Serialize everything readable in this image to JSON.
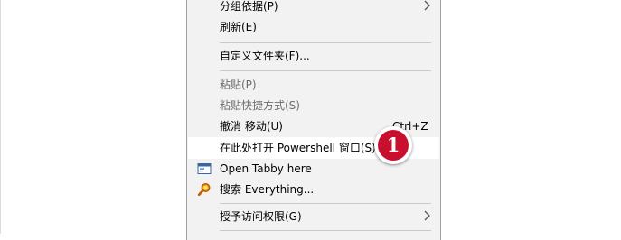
{
  "menu": {
    "items": [
      {
        "label": "分组依据(P)",
        "has_submenu": true
      },
      {
        "label": "刷新(E)"
      },
      {
        "label": "自定义文件夹(F)..."
      },
      {
        "label": "粘贴(P)",
        "disabled": true
      },
      {
        "label": "粘贴快捷方式(S)",
        "disabled": true
      },
      {
        "label": "撤消 移动(U)",
        "shortcut": "Ctrl+Z"
      },
      {
        "label": "在此处打开 Powershell 窗口(S)",
        "highlighted": true
      },
      {
        "label": "Open Tabby here",
        "icon": "tabby-terminal-icon"
      },
      {
        "label": "搜索 Everything...",
        "icon": "everything-search-icon"
      },
      {
        "label": "授予访问权限(G)",
        "has_submenu": true
      }
    ]
  },
  "annotation": {
    "badge": "1"
  },
  "colors": {
    "menu_bg": "#f2f2f2",
    "highlight_bg": "#ffffff",
    "badge_red": "#c8102e",
    "everything_orange": "#e07b00"
  }
}
